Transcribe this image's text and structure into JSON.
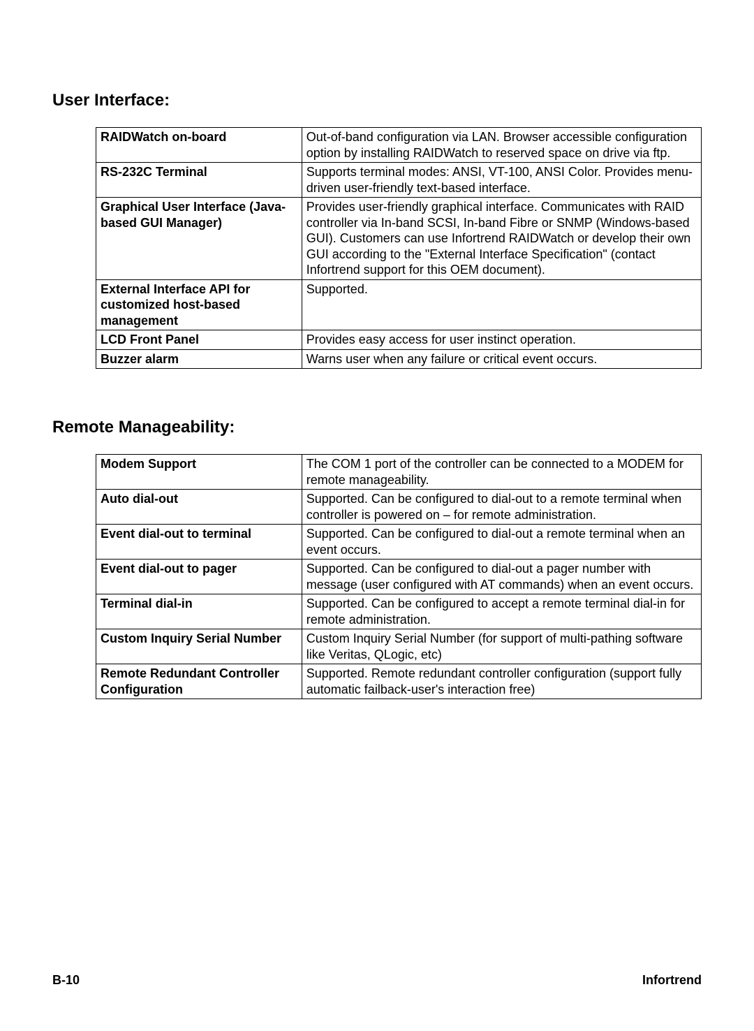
{
  "sections": [
    {
      "heading": "User Interface:",
      "rows": [
        {
          "label": "RAIDWatch on-board",
          "value": "Out-of-band configuration via LAN.  Browser accessible configuration option by installing RAIDWatch to reserved space on drive via ftp."
        },
        {
          "label": "RS-232C Terminal",
          "value": "Supports terminal modes: ANSI, VT-100, ANSI Color. Provides menu-driven user-friendly text-based interface."
        },
        {
          "label": "Graphical User Interface (Java-based GUI Manager)",
          "value": "Provides user-friendly graphical interface. Communicates with RAID controller via In-band SCSI, In-band Fibre or SNMP (Windows-based GUI). Customers can use Infortrend RAIDWatch or develop their own GUI according to the \"External Interface Specification\" (contact Infortrend support for this OEM document)."
        },
        {
          "label": "External Interface API for customized host-based management",
          "value": "Supported."
        },
        {
          "label": "LCD Front Panel",
          "value": "Provides easy access for user instinct operation."
        },
        {
          "label": "Buzzer alarm",
          "value": "Warns user when any failure or critical event occurs."
        }
      ]
    },
    {
      "heading": "Remote Manageability:",
      "rows": [
        {
          "label": "Modem Support",
          "value": "The COM 1 port of the controller can be connected to a MODEM for remote manageability."
        },
        {
          "label": "Auto dial-out",
          "value": "Supported.  Can be configured to dial-out to a remote terminal when controller is powered on – for remote administration."
        },
        {
          "label": "Event dial-out to terminal",
          "value": "Supported.  Can be configured to dial-out a remote terminal when an event occurs."
        },
        {
          "label": "Event dial-out to pager",
          "value": "Supported.  Can be configured to dial-out a pager number with message (user configured with AT commands) when an event occurs."
        },
        {
          "label": "Terminal dial-in",
          "value": "Supported.  Can be configured to accept a remote terminal dial-in for remote administration."
        },
        {
          "label": "Custom Inquiry Serial Number",
          "value": "Custom Inquiry Serial Number (for support of multi-pathing software like Veritas, QLogic, etc)"
        },
        {
          "label": "Remote Redundant Controller Configuration",
          "value": "Supported.  Remote redundant controller configuration (support fully automatic failback-user's interaction free)"
        }
      ]
    }
  ],
  "footer": {
    "left": "B-10",
    "right": "Infortrend"
  }
}
